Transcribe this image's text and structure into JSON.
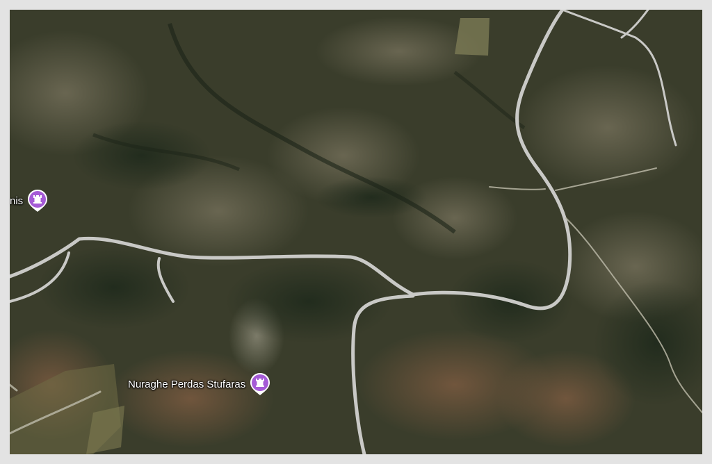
{
  "map": {
    "type": "satellite",
    "pois": [
      {
        "label": "nis",
        "icon": "castle-icon",
        "color": "#a55bd6"
      },
      {
        "label": "Nuraghe Perdas Stufaras",
        "icon": "castle-icon",
        "color": "#a55bd6"
      }
    ]
  },
  "colors": {
    "frame": "#e3e3e3",
    "road": "#c8c8c8",
    "terrain_dark": "#2e3325",
    "terrain_light": "#6b6650"
  }
}
